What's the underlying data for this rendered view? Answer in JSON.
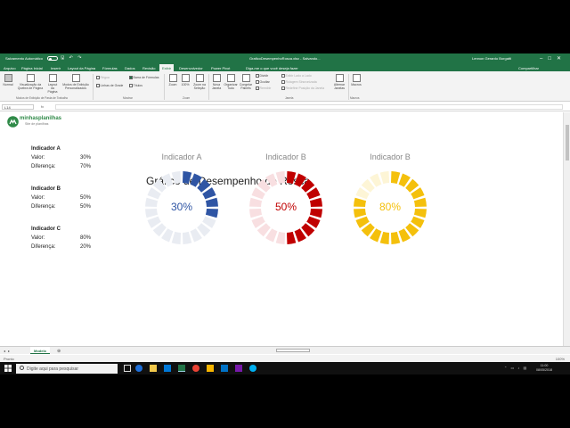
{
  "titlebar": {
    "autosave": "Salvamento Automático",
    "document": "GraficoDesempenhoRosca.xlsx - Salvando...",
    "user": "Lennon Gerardo Borgatti"
  },
  "tabs": [
    "Arquivo",
    "Página Inicial",
    "Inserir",
    "Layout da Página",
    "Fórmulas",
    "Dados",
    "Revisão",
    "Exibir",
    "Desenvolvedor",
    "Power Pivot"
  ],
  "active_tab": "Exibir",
  "tell_me": "Diga-me o que você deseja fazer",
  "share": "Compartilhar",
  "ribbon": {
    "normal": "Normal",
    "page_break": "Visualização da Quebra de Página",
    "page_layout": "Layout da Página",
    "custom_views": "Modos de Exibição Personalizados",
    "rulers": "Régua",
    "formula_bar": "Barra de Fórmulas",
    "gridlines": "Linhas de Grade",
    "headings": "Títulos",
    "zoom": "Zoom",
    "zoom100": "100%",
    "zoom_selection": "Zoom na Seleção",
    "new_window": "Nova Janela",
    "arrange_all": "Organizar Tudo",
    "freeze": "Congelar Painéis",
    "split": "Dividir",
    "hide": "Ocultar",
    "unhide": "Reexibir",
    "side_by_side": "Exibir Lado a Lado",
    "sync_scroll": "Rolagem Sincronizada",
    "reset_pos": "Redefinir Posição da Janela",
    "switch_windows": "Alternar Janelas",
    "macros": "Macros",
    "group_views": "Modos de Exibição de Pasta de Trabalho",
    "group_show": "Mostrar",
    "group_zoom": "Zoom",
    "group_window": "Janela",
    "group_macros": "Macros"
  },
  "formula_bar": {
    "cell": "L14",
    "fx": "fx"
  },
  "logo": {
    "name": "minhasplanilhas",
    "tagline": "Site de planilhas"
  },
  "sheet_title": "Gráfico de Desempenho de Rosca",
  "indicators": [
    {
      "title": "Indicador A",
      "valor_label": "Valor:",
      "valor": "30%",
      "dif_label": "Diferença:",
      "diferenca": "70%"
    },
    {
      "title": "Indicador B",
      "valor_label": "Valor:",
      "valor": "50%",
      "dif_label": "Diferença:",
      "diferenca": "50%"
    },
    {
      "title": "Indicador C",
      "valor_label": "Valor:",
      "valor": "80%",
      "dif_label": "Diferença:",
      "diferenca": "20%"
    }
  ],
  "donuts": [
    {
      "title": "Indicador A",
      "label": "30%",
      "fraction": 0.3,
      "color": "#2f55a4",
      "track": "#e9ecf2"
    },
    {
      "title": "Indicador B",
      "label": "50%",
      "fraction": 0.5,
      "color": "#c00000",
      "track": "#f8dfe1"
    },
    {
      "title": "Indicador B",
      "label": "80%",
      "fraction": 0.8,
      "color": "#f4c00c",
      "track": "#fdf5d6"
    }
  ],
  "sheet_tab": "Modelo",
  "status": {
    "ready": "Pronto",
    "zoom": "100%"
  },
  "taskbar": {
    "search_placeholder": "Digite aqui para pesquisar",
    "time": "11:00",
    "date": "08/05/2018"
  }
}
